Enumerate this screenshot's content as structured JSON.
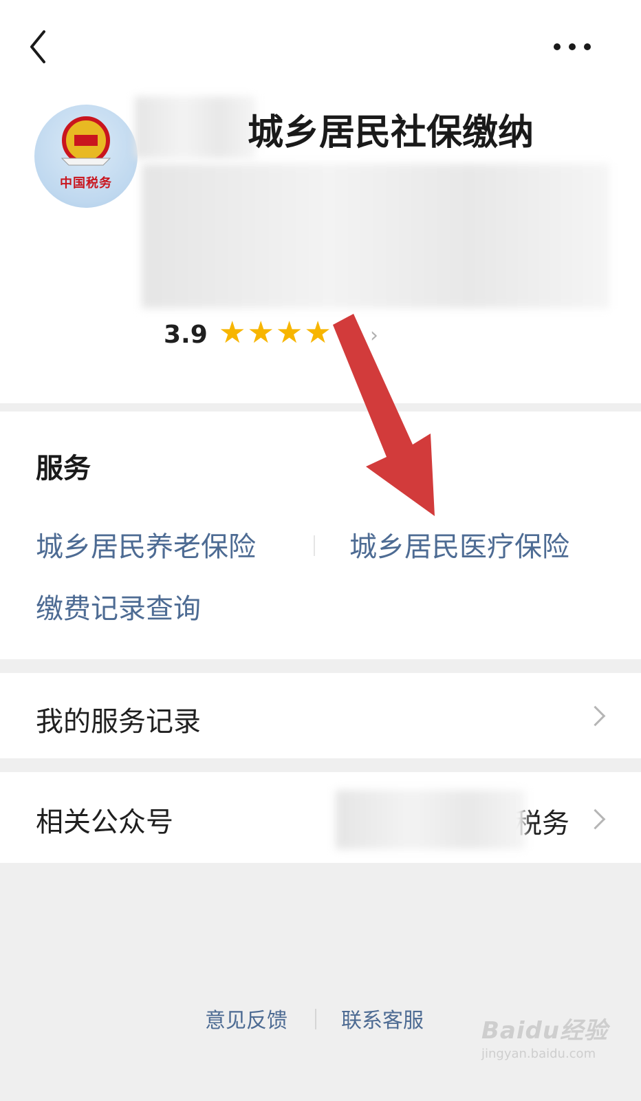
{
  "header": {
    "back_icon": "chevron-left-icon",
    "more_icon": "more-dots-icon"
  },
  "profile": {
    "logo_text": "中国税务",
    "title_visible": "城乡居民社保缴纳",
    "rating": "3.9",
    "stars_display": "★★★★",
    "rating_stars": 3.9
  },
  "services": {
    "title": "服务",
    "items": [
      {
        "label": "城乡居民养老保险"
      },
      {
        "label": "城乡居民医疗保险"
      },
      {
        "label": "缴费记录查询"
      }
    ]
  },
  "rows": {
    "records": {
      "label": "我的服务记录"
    },
    "accounts": {
      "label": "相关公众号",
      "value": "税务"
    }
  },
  "footer": {
    "feedback": "意见反馈",
    "customer_service": "联系客服"
  },
  "watermark": {
    "main": "Baidu经验",
    "sub": "jingyan.baidu.com"
  },
  "colors": {
    "link": "#4d6b93",
    "star": "#f7b500",
    "arrow": "#d23b3b",
    "background": "#efefef"
  }
}
